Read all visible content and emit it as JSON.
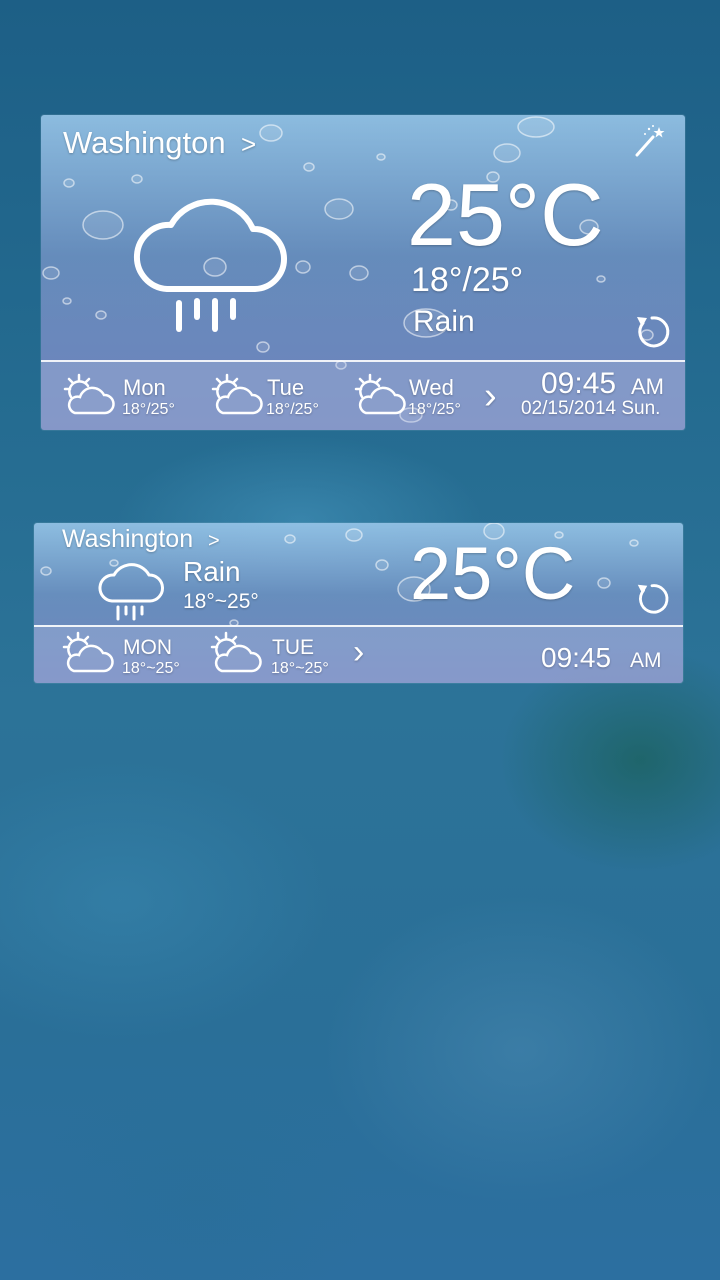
{
  "widget_large": {
    "city": "Washington",
    "city_arrow": ">",
    "temperature": "25°C",
    "range": "18°/25°",
    "condition": "Rain",
    "forecast": [
      {
        "day": "Mon",
        "range": "18°/25°"
      },
      {
        "day": "Tue",
        "range": "18°/25°"
      },
      {
        "day": "Wed",
        "range": "18°/25°"
      }
    ],
    "more_arrow": "›",
    "time": "09:45",
    "ampm": "AM",
    "date": "02/15/2014 Sun."
  },
  "widget_small": {
    "city": "Washington",
    "city_arrow": ">",
    "condition": "Rain",
    "range": "18°~25°",
    "temperature": "25°C",
    "forecast": [
      {
        "day": "MON",
        "range": "18°~25°"
      },
      {
        "day": "TUE",
        "range": "18°~25°"
      }
    ],
    "more_arrow": "›",
    "time": "09:45",
    "ampm": "AM"
  },
  "icons": {
    "condition": "rain-cloud-icon",
    "forecast": "partly-cloudy-icon",
    "refresh": "refresh-icon",
    "theme": "magic-wand-icon"
  }
}
